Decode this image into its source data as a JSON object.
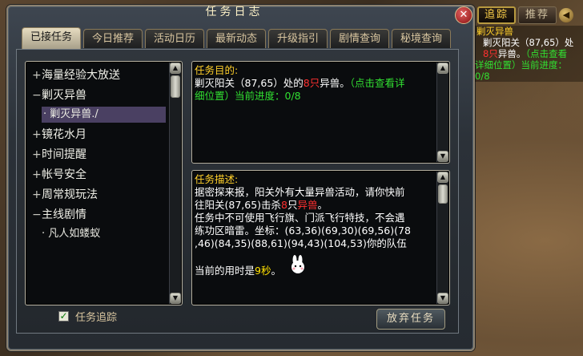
{
  "window": {
    "title": "任务日志",
    "close": "✕"
  },
  "tabs": [
    "已接任务",
    "今日推荐",
    "活动日历",
    "最新动态",
    "升级指引",
    "剧情查询",
    "秘境查询"
  ],
  "quest_list": [
    {
      "pm": "+",
      "label": "海量经验大放送"
    },
    {
      "pm": "−",
      "label": "剿灭异兽"
    },
    {
      "sub": "·",
      "label": "剿灭异兽./"
    },
    {
      "pm": "+",
      "label": "镜花水月"
    },
    {
      "pm": "+",
      "label": "时间提醒"
    },
    {
      "pm": "+",
      "label": "帐号安全"
    },
    {
      "pm": "+",
      "label": "周常规玩法"
    },
    {
      "pm": "−",
      "label": "主线剧情"
    },
    {
      "sub": "·",
      "label": "凡人如蝼蚁"
    }
  ],
  "goal": {
    "heading": "任务目的:",
    "l1a": "剿灭阳关（87,65）处的",
    "l1b": "8只",
    "l1c": "异兽。",
    "l1d": "（点击查看详",
    "l2": "细位置）当前进度：0/8"
  },
  "desc": {
    "heading": "任务描述:",
    "l1": "据密探来报，阳关外有大量异兽活动，请你快前",
    "l2a": "往阳关(87,65)击杀",
    "l2b": "8",
    "l2c": "只",
    "l2d": "异兽",
    "l2e": "。",
    "l3": "任务中不可使用飞行旗、门派飞行特技，不会遇",
    "l4": "练功区暗雷。坐标：(63,36)(69,30)(69,56)(78",
    "l5": ",46)(84,35)(88,61)(94,43)(104,53)你的队伍",
    "l6a": "当前的用时是",
    "l6b": "9秒",
    "l6c": "。"
  },
  "track_label": "任务追踪",
  "track_check": "✓",
  "abandon": "放弃任务",
  "right": {
    "tab_track": "追踪",
    "tab_recommend": "推荐",
    "arrow": "◀",
    "r1": "剿灭异兽",
    "r2": "剿灭阳关（87,65）处",
    "r3a": "8只",
    "r3b": "异兽。",
    "r3c": "（点击查看",
    "r4": "详细位置）当前进度：",
    "r5": "0/8"
  },
  "colors": {
    "heading": "#ffd02a",
    "link": "#31e031",
    "highlight": "#ff3030",
    "count": "#ffe000"
  }
}
